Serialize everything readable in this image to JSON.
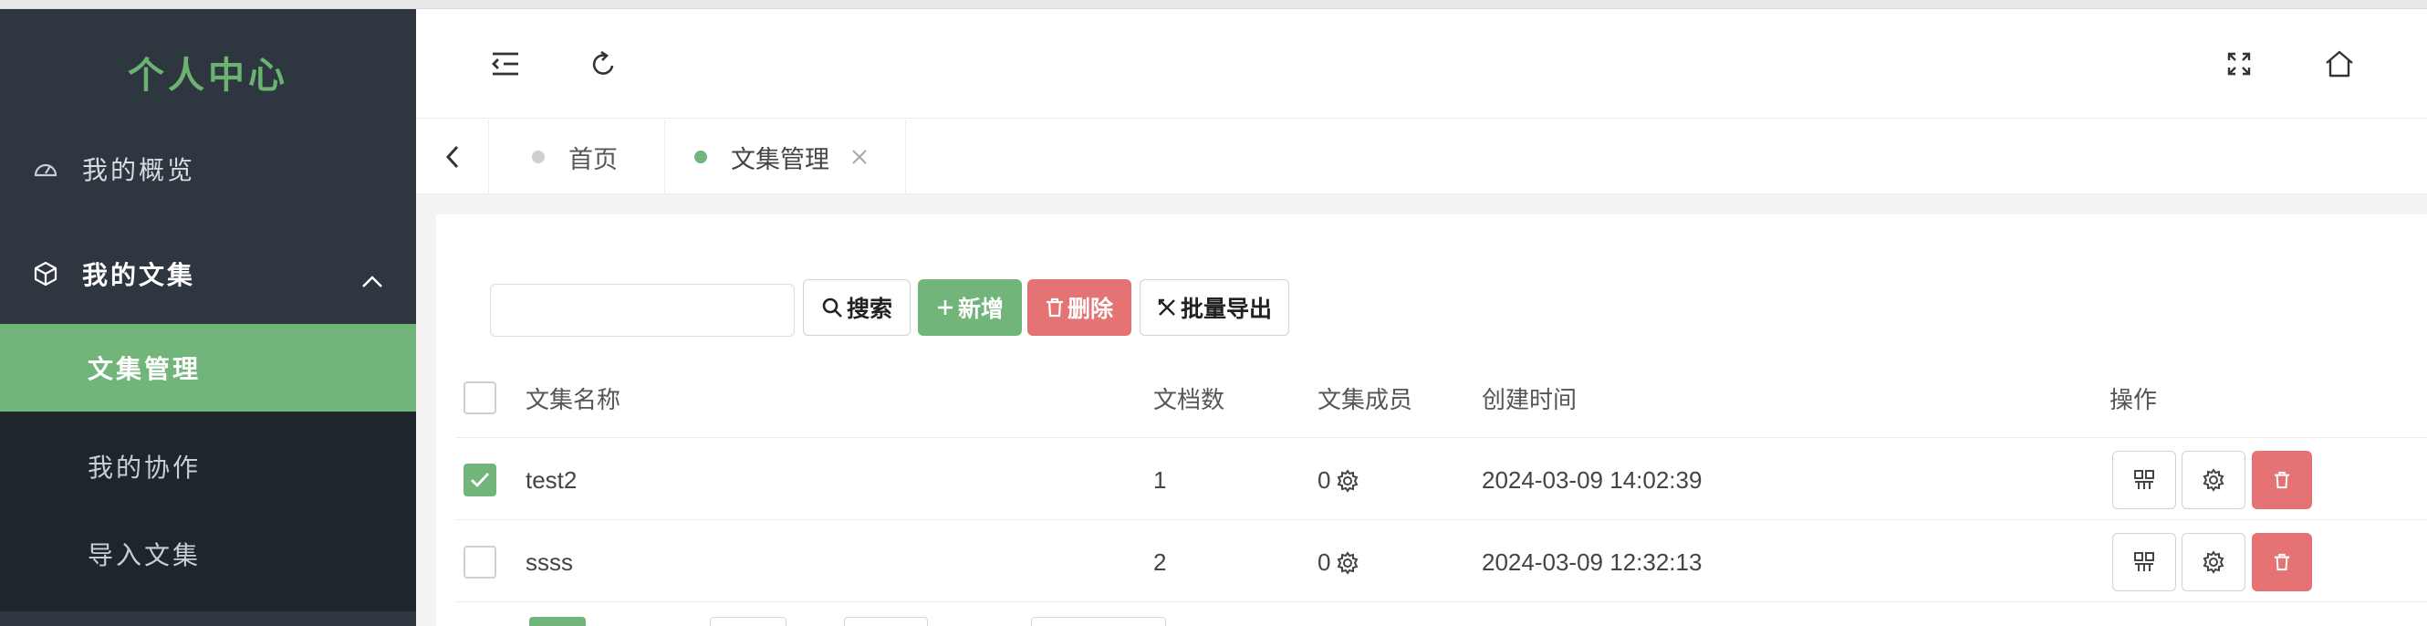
{
  "sidebar": {
    "brand": "个人中心",
    "overview_label": "我的概览",
    "collections_label": "我的文集",
    "submenu": [
      "文集管理",
      "我的协作",
      "导入文集"
    ]
  },
  "tabs": [
    {
      "label": "首页"
    },
    {
      "label": "文集管理"
    }
  ],
  "toolbar": {
    "search_placeholder": "",
    "search_label": "搜索",
    "add_label": "新增",
    "delete_label": "删除",
    "export_label": "批量导出"
  },
  "table": {
    "headers": {
      "name": "文集名称",
      "docs": "文档数",
      "members": "文集成员",
      "created": "创建时间",
      "actions": "操作"
    },
    "rows": [
      {
        "name": "test2",
        "docs": "1",
        "members": "0",
        "created": "2024-03-09 14:02:39",
        "checked": true
      },
      {
        "name": "ssss",
        "docs": "2",
        "members": "0",
        "created": "2024-03-09 12:32:13",
        "checked": false
      }
    ]
  },
  "colors": {
    "sidebar_bg": "#2e3640",
    "submenu_bg": "#1f252d",
    "accent_green": "#72b57b",
    "danger_red": "#e57373"
  }
}
